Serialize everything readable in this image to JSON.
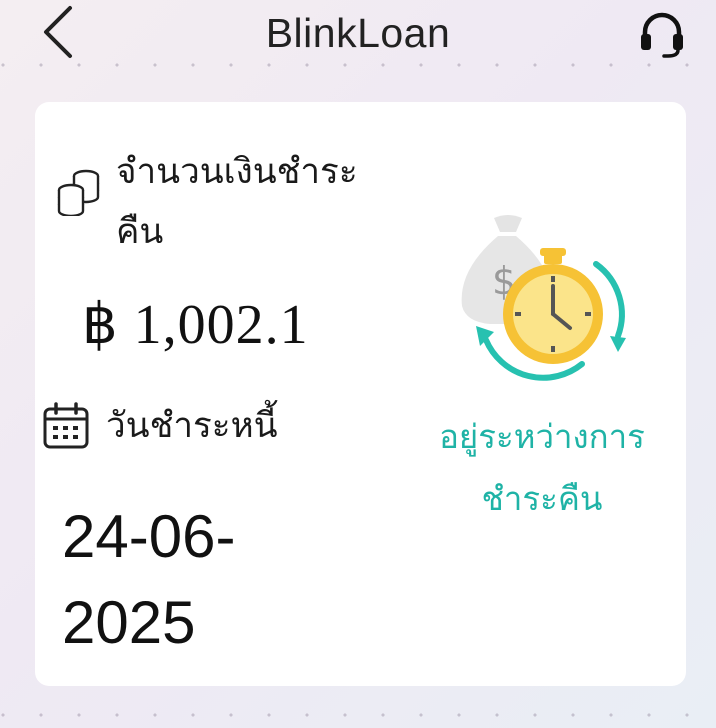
{
  "header": {
    "title": "BlinkLoan",
    "back_icon": "chevron-left-icon",
    "support_icon": "headset-icon"
  },
  "card": {
    "amount_label": "จำนวนเงินชำระคืน",
    "amount_value": "฿ 1,002.1",
    "due_label": "วันชำระหนี้",
    "due_date": "24-06-2025",
    "status": "อยู่ระหว่างการชำระคืน",
    "icons": {
      "amount": "coins-icon",
      "due": "calendar-icon",
      "status": "money-bag-stopwatch-icon"
    }
  },
  "colors": {
    "status": "#1fb3a6",
    "illustration_gold": "#f6c235",
    "illustration_teal": "#27c1b0"
  }
}
